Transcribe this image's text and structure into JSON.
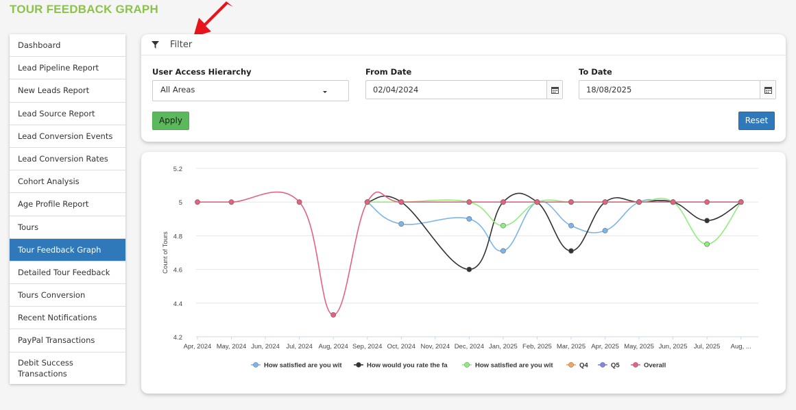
{
  "page": {
    "title": "TOUR FEEDBACK GRAPH"
  },
  "colors": {
    "accent_green": "#8bc34a",
    "primary_blue": "#2f78b9",
    "apply_green": "#5cb85c",
    "arrow_red": "#e8141c"
  },
  "sidebar": {
    "items": [
      {
        "label": "Dashboard"
      },
      {
        "label": "Lead Pipeline Report"
      },
      {
        "label": "New Leads Report"
      },
      {
        "label": "Lead Source Report"
      },
      {
        "label": "Lead Conversion Events"
      },
      {
        "label": "Lead Conversion Rates"
      },
      {
        "label": "Cohort Analysis"
      },
      {
        "label": "Age Profile Report"
      },
      {
        "label": "Tours"
      },
      {
        "label": "Tour Feedback Graph",
        "active": true
      },
      {
        "label": "Detailed Tour Feedback"
      },
      {
        "label": "Tours Conversion"
      },
      {
        "label": "Recent Notifications"
      },
      {
        "label": "PayPal Transactions"
      },
      {
        "label": "Debit Success Transactions"
      }
    ]
  },
  "filter": {
    "header": "Filter",
    "icon": "funnel-icon",
    "hierarchy_label": "User Access Hierarchy",
    "hierarchy_value": "All Areas",
    "from_label": "From Date",
    "from_value": "02/04/2024",
    "to_label": "To Date",
    "to_value": "18/08/2025",
    "apply_label": "Apply",
    "reset_label": "Reset"
  },
  "chart_data": {
    "type": "line",
    "ylabel": "Count of Tours",
    "xlabel": "",
    "ylim": [
      4.2,
      5.2
    ],
    "yticks": [
      4.2,
      4.4,
      4.6,
      4.8,
      5,
      5.2
    ],
    "grid": true,
    "legend_position": "bottom",
    "categories": [
      "Apr, 2024",
      "May, 2024",
      "Jun, 2024",
      "Jul, 2024",
      "Aug, 2024",
      "Sep, 2024",
      "Oct, 2024",
      "Nov, 2024",
      "Dec, 2024",
      "Jan, 2025",
      "Feb, 2025",
      "Mar, 2025",
      "Apr, 2025",
      "May, 2025",
      "Jun, 2025",
      "Jul, 2025",
      "Aug, ..."
    ],
    "series": [
      {
        "name": "How satisfied are you wit",
        "color": "#7cb5ec",
        "values": [
          null,
          null,
          null,
          null,
          null,
          5,
          4.87,
          null,
          4.9,
          4.71,
          5,
          4.86,
          4.83,
          5,
          5,
          null,
          5
        ]
      },
      {
        "name": "How would you rate the fa",
        "color": "#333333",
        "values": [
          null,
          null,
          null,
          null,
          null,
          5,
          5,
          null,
          4.6,
          5,
          5,
          4.71,
          5,
          5,
          5,
          4.89,
          5
        ]
      },
      {
        "name": "How satisfied are you wit",
        "color": "#90ed7d",
        "values": [
          null,
          null,
          null,
          null,
          null,
          5,
          5,
          null,
          5,
          4.86,
          5,
          5,
          5,
          5,
          5,
          4.75,
          5
        ]
      },
      {
        "name": "Q4",
        "color": "#f7a35c",
        "values": []
      },
      {
        "name": "Q5",
        "color": "#8085e9",
        "values": []
      },
      {
        "name": "Overall",
        "color": "#e4627f",
        "values": [
          5,
          5,
          null,
          5,
          4.33,
          5,
          5,
          null,
          5,
          5,
          5,
          5,
          5,
          5,
          5,
          5,
          5
        ]
      }
    ]
  }
}
